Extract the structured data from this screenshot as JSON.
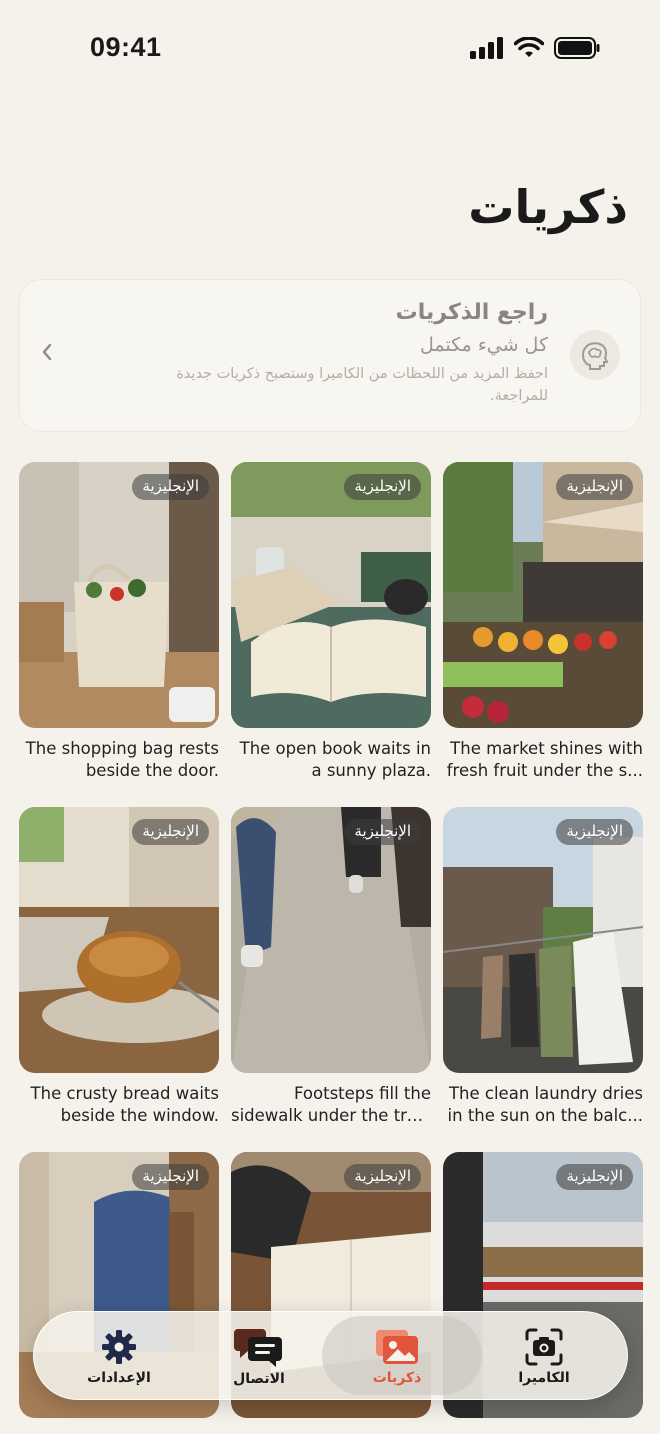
{
  "status": {
    "time": "09:41"
  },
  "page": {
    "title": "ذكريات"
  },
  "review": {
    "title": "راجع الذكريات",
    "subtitle": "كل شيء مكتمل",
    "description": "احفظ المزيد من اللحظات من الكاميرا وستصبح ذكريات جديدة للمراجعة."
  },
  "memories": [
    {
      "badge": "الإنجليزية",
      "line1": "The shopping bag rests",
      "line2": "beside the door."
    },
    {
      "badge": "الإنجليزية",
      "line1": "The open book waits in",
      "line2": "a sunny plaza."
    },
    {
      "badge": "الإنجليزية",
      "line1": "The market shines with",
      "line2": "fresh fruit under the s..."
    },
    {
      "badge": "الإنجليزية",
      "line1": "The crusty bread waits",
      "line2": "beside the window."
    },
    {
      "badge": "الإنجليزية",
      "line1": "Footsteps fill the",
      "line2": "sidewalk under the tre..."
    },
    {
      "badge": "الإنجليزية",
      "line1": "The clean laundry dries",
      "line2": "in the sun on the balc..."
    },
    {
      "badge": "الإنجليزية",
      "line1": "",
      "line2": ""
    },
    {
      "badge": "الإنجليزية",
      "line1": "",
      "line2": ""
    },
    {
      "badge": "الإنجليزية",
      "line1": "",
      "line2": ""
    }
  ],
  "tabs": [
    {
      "label": "الإعدادات",
      "icon": "gear-icon"
    },
    {
      "label": "الاتصال",
      "icon": "chat-bubbles-icon"
    },
    {
      "label": "ذكريات",
      "icon": "photos-icon"
    },
    {
      "label": "الكاميرا",
      "icon": "camera-icon"
    }
  ],
  "colors": {
    "background": "#f5f2ec",
    "accent": "#e0553b"
  }
}
